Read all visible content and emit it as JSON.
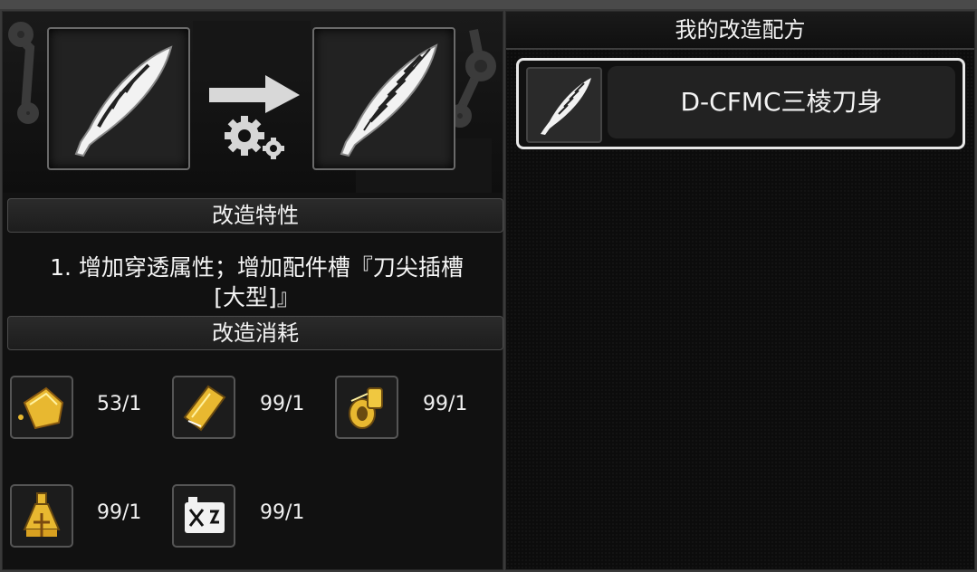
{
  "modify": {
    "trait_header": "改造特性",
    "trait_text_line1": "1. 增加穿透属性；增加配件槽『刀尖插槽",
    "trait_text_line2": "[大型]』",
    "cost_header": "改造消耗",
    "materials": [
      {
        "icon": "gold-plate-icon",
        "count": "53/1"
      },
      {
        "icon": "gold-card-icon",
        "count": "99/1"
      },
      {
        "icon": "gold-spool-icon",
        "count": "99/1"
      },
      {
        "icon": "flask-icon",
        "count": "99/1"
      },
      {
        "icon": "broken-battery-icon",
        "count": "99/1"
      }
    ]
  },
  "recipes": {
    "title": "我的改造配方",
    "items": [
      {
        "name": "D-CFMC三棱刀身"
      }
    ]
  },
  "colors": {
    "gold": "#e8b830",
    "panel": "#111111",
    "border": "#e8e8e8"
  }
}
